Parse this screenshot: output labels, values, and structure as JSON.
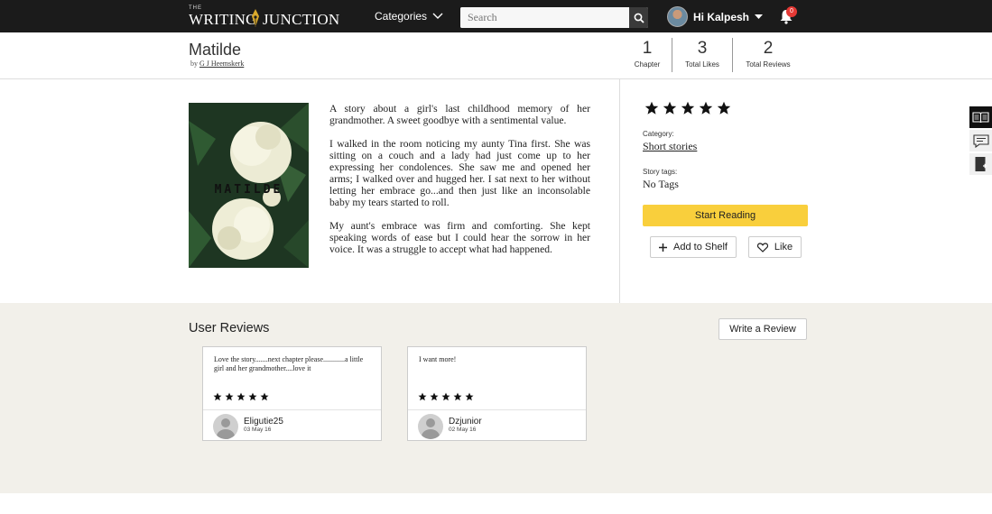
{
  "header": {
    "logo_the": "THE",
    "logo_writing": "WRITING",
    "logo_junction": "JUNCTION",
    "categories_label": "Categories",
    "search_placeholder": "Search",
    "greeting": "Hi Kalpesh",
    "notification_count": "0"
  },
  "story": {
    "title": "Matilde",
    "by_prefix": "by",
    "author": "G J Heemskerk",
    "cover_text": "MATILDE",
    "stats": [
      {
        "value": "1",
        "label": "Chapter"
      },
      {
        "value": "3",
        "label": "Total Likes"
      },
      {
        "value": "2",
        "label": "Total Reviews"
      }
    ],
    "description": [
      "A story about a girl's last childhood memory of her grandmother. A sweet goodbye with a sentimental value.",
      "I walked in the room noticing my aunty Tina first. She was sitting on a couch and a lady had just come up to her expressing her condolences. She saw me and opened her arms; I walked over and hugged her. I sat next to her without letting her embrace go...and then just like an inconsolable baby my tears started to roll.",
      "My aunt's embrace was firm and comforting. She kept speaking words of ease but I could hear the sorrow in her voice. It was a struggle to accept what had happened."
    ],
    "rating": 5,
    "category_label": "Category:",
    "category": "Short stories",
    "tags_label": "Story tags:",
    "tags": "No Tags",
    "start_reading_label": "Start Reading",
    "add_to_shelf_label": "Add to Shelf",
    "like_label": "Like"
  },
  "reviews": {
    "heading": "User Reviews",
    "write_label": "Write a Review",
    "items": [
      {
        "text": "Love the story.......next chapter please............a little girl and her grandmother....love it",
        "rating": 5,
        "user": "Eligutie25",
        "date": "03 May 16"
      },
      {
        "text": "I want more!",
        "rating": 5,
        "user": "Dzjunior",
        "date": "02 May 16"
      }
    ]
  },
  "colors": {
    "topbar": "#1b1b1b",
    "accent_yellow": "#f9cf3c",
    "reviews_bg": "#f2f0ea",
    "badge_red": "#e53935"
  }
}
